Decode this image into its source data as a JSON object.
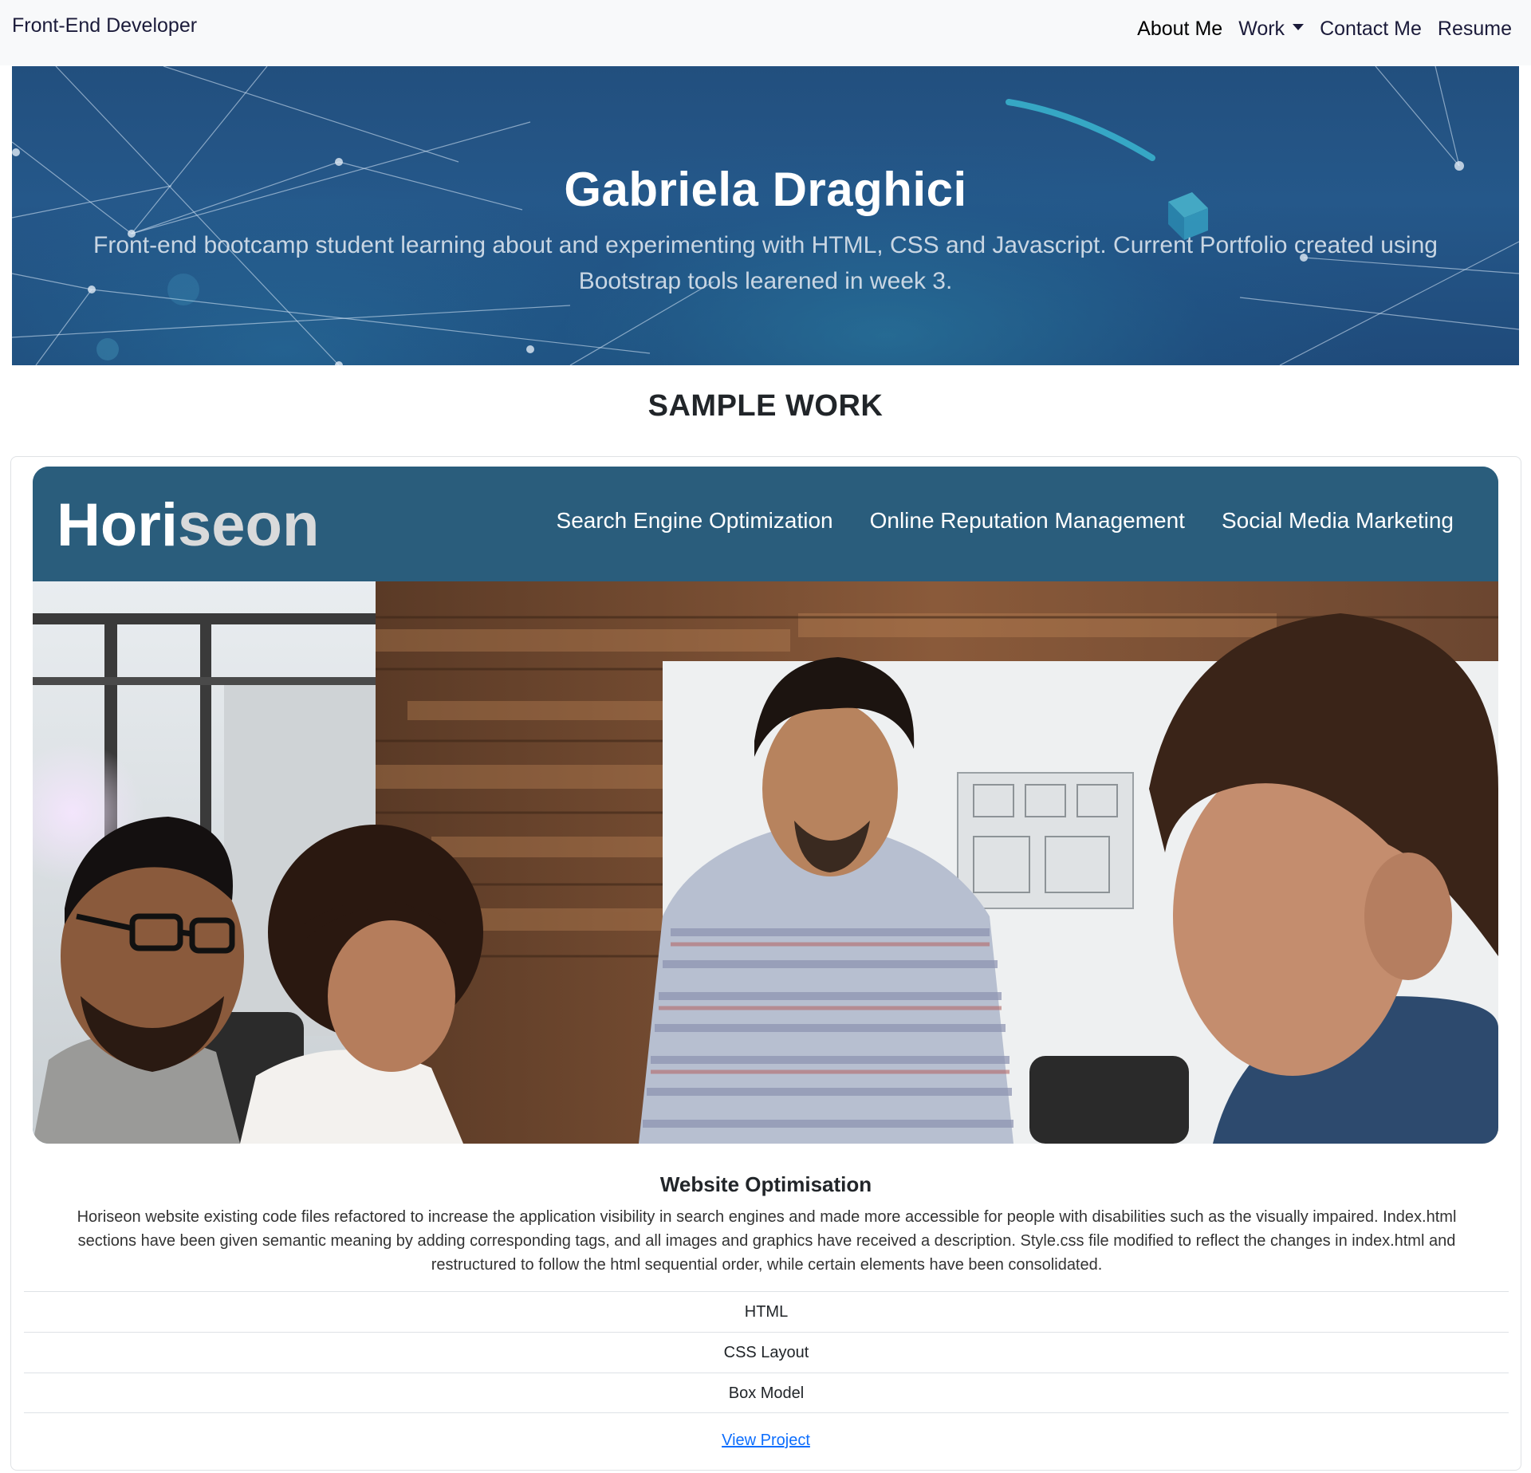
{
  "nav": {
    "brand": "Front-End Developer",
    "links": [
      "About Me",
      "Work",
      "Contact Me",
      "Resume"
    ]
  },
  "hero": {
    "title": "Gabriela Draghici",
    "subtitle": "Front-end bootcamp student learning about and experimenting with HTML, CSS and Javascript. Current Portfolio created using Bootstrap tools learened in week 3."
  },
  "section": {
    "title": "SAMPLE WORK"
  },
  "project": {
    "screenshot": {
      "logo_a": "Hori",
      "logo_b": "seon",
      "nav": [
        "Search Engine Optimization",
        "Online Reputation Management",
        "Social Media Marketing"
      ]
    },
    "title": "Website Optimisation",
    "description": "Horiseon website existing code files refactored to increase the application visibility in search engines and made more accessible for people with disabilities such as the visually impaired. Index.html sections have been given semantic meaning by adding corresponding tags, and all images and graphics have received a description. Style.css file modified to reflect the changes in index.html and restructured to follow the html sequential order, while certain elements have been consolidated.",
    "tags": [
      "HTML",
      "CSS Layout",
      "Box Model"
    ],
    "link": "View Project"
  },
  "colors": {
    "navbar_bg": "#f8f9fa",
    "hero_bg": "#245785",
    "horiseon_header": "#2a5d7c",
    "link": "#0d6efd"
  }
}
